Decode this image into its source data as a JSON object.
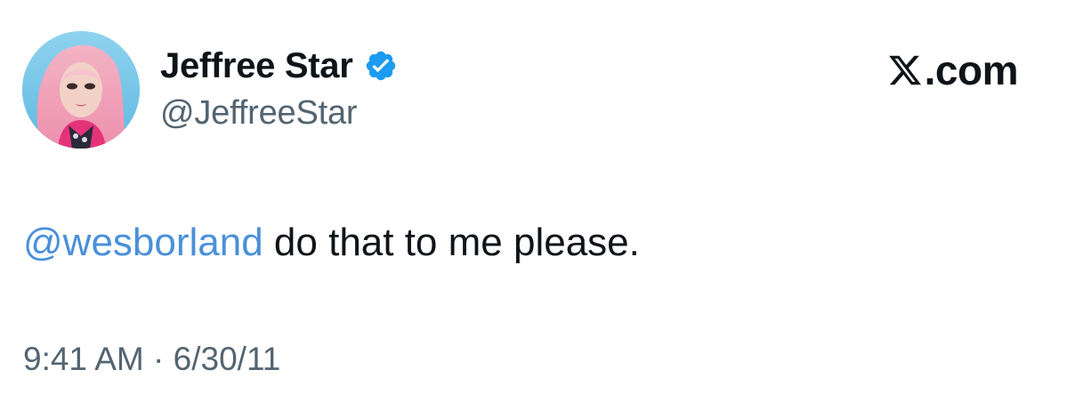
{
  "author": {
    "display_name": "Jeffree Star",
    "handle": "@JeffreeStar",
    "verified": true,
    "avatar_icon": "profile-avatar"
  },
  "site": {
    "logo_text": ".com",
    "logo_icon": "x-logo-icon"
  },
  "tweet": {
    "mention": "@wesborland",
    "text": " do that to me please.",
    "time": "9:41 AM",
    "separator": "·",
    "date": "6/30/11"
  },
  "colors": {
    "mention": "#4a90d9",
    "verified_badge": "#1d9bf0",
    "text": "#0f1419",
    "secondary": "#536471",
    "background": "#ffffff"
  }
}
